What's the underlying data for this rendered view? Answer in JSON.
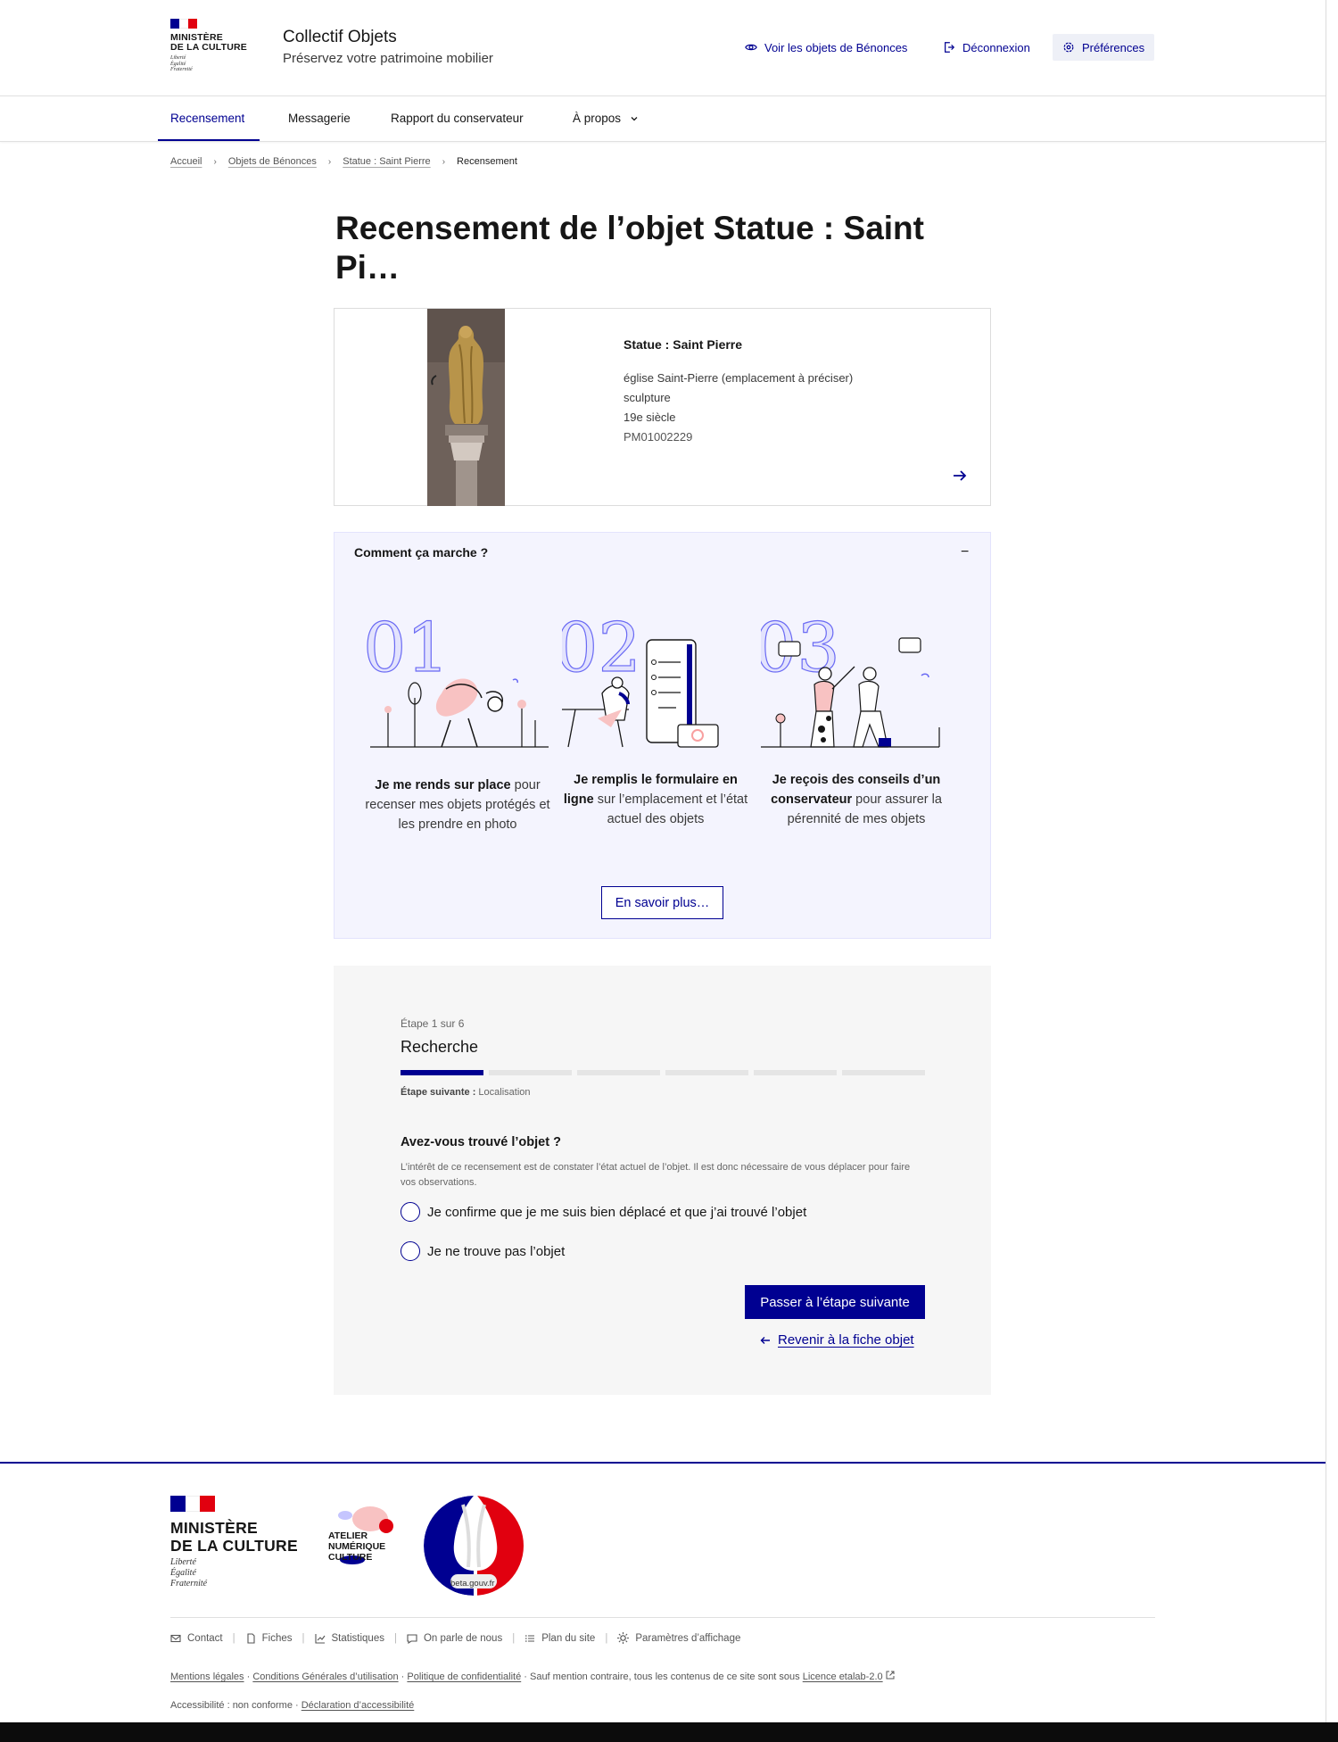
{
  "header": {
    "gov_name_line1": "MINISTÈRE",
    "gov_name_line2": "DE LA CULTURE",
    "gov_motto": [
      "Liberté",
      "Égalité",
      "Fraternité"
    ],
    "site_title": "Collectif Objets",
    "site_tagline": "Préservez votre patrimoine mobilier",
    "tools": {
      "view_objects": "Voir les objets de Bénonces",
      "logout": "Déconnexion",
      "preferences": "Préférences"
    }
  },
  "nav": {
    "items": [
      {
        "label": "Recensement",
        "active": true
      },
      {
        "label": "Messagerie"
      },
      {
        "label": "Rapport du conservateur"
      },
      {
        "label": "À propos"
      }
    ]
  },
  "breadcrumb": {
    "items": [
      "Accueil",
      "Objets de Bénonces",
      "Statue : Saint Pierre"
    ],
    "current": "Recensement"
  },
  "page_title": "Recensement de l’objet Statue : Saint Pi…",
  "object_card": {
    "title": "Statue : Saint Pierre",
    "location": "église Saint-Pierre (emplacement à préciser)",
    "category": "sculpture",
    "century": "19e siècle",
    "reference": "PM01002229"
  },
  "how_it_works": {
    "title": "Comment ça marche ?",
    "collapse_symbol": "−",
    "steps": [
      {
        "number": "01",
        "bold": "Je me rends sur place",
        "rest": " pour recenser mes objets protégés et les prendre en photo"
      },
      {
        "number": "02",
        "bold": "Je remplis le formulaire en ligne",
        "rest": " sur l’emplacement et l’état actuel des objets"
      },
      {
        "number": "03",
        "bold": "Je reçois des conseils d’un conservateur",
        "rest": " pour assurer la pérennité de mes objets"
      }
    ],
    "more_button": "En savoir plus…"
  },
  "form": {
    "step_count": "Étape 1 sur 6",
    "step_title": "Recherche",
    "progress": {
      "current": 1,
      "total": 6
    },
    "next_step_label": "Étape suivante :",
    "next_step_value": "Localisation",
    "question": "Avez-vous trouvé l’objet ?",
    "hint": "L’intérêt de ce recensement est de constater l’état actuel de l’objet. Il est donc nécessaire de vous déplacer pour faire vos observations.",
    "options": [
      "Je confirme que je me suis bien déplacé et que j’ai trouvé l’objet",
      "Je ne trouve pas l’objet"
    ],
    "submit": "Passer à l’étape suivante",
    "back": "Revenir à la fiche objet"
  },
  "footer": {
    "gov_name_line1": "MINISTÈRE",
    "gov_name_line2": "DE LA CULTURE",
    "gov_motto": [
      "Liberté",
      "Égalité",
      "Fraternité"
    ],
    "anc_lines": [
      "ATELIER",
      "NUMÉRIQUE",
      "CULTURE"
    ],
    "beta_label": "beta.gouv.fr",
    "links": [
      "Contact",
      "Fiches",
      "Statistiques",
      "On parle de nous",
      "Plan du site",
      "Paramètres d’affichage"
    ],
    "legal": {
      "mentions": "Mentions légales",
      "cgu": "Conditions Générales d’utilisation",
      "privacy": "Politique de confidentialité",
      "notice": "Sauf mention contraire, tous les contenus de ce site sont sous",
      "licence": "Licence etalab-2.0"
    },
    "accessibility": {
      "status": "Accessibilité : non conforme",
      "declaration": "Déclaration d’accessibilité"
    }
  },
  "colors": {
    "primary": "#000091",
    "flag_blue": "#000091",
    "flag_red": "#e1000f",
    "how_bg": "#f4f4fe",
    "form_bg": "#f6f6f6"
  }
}
